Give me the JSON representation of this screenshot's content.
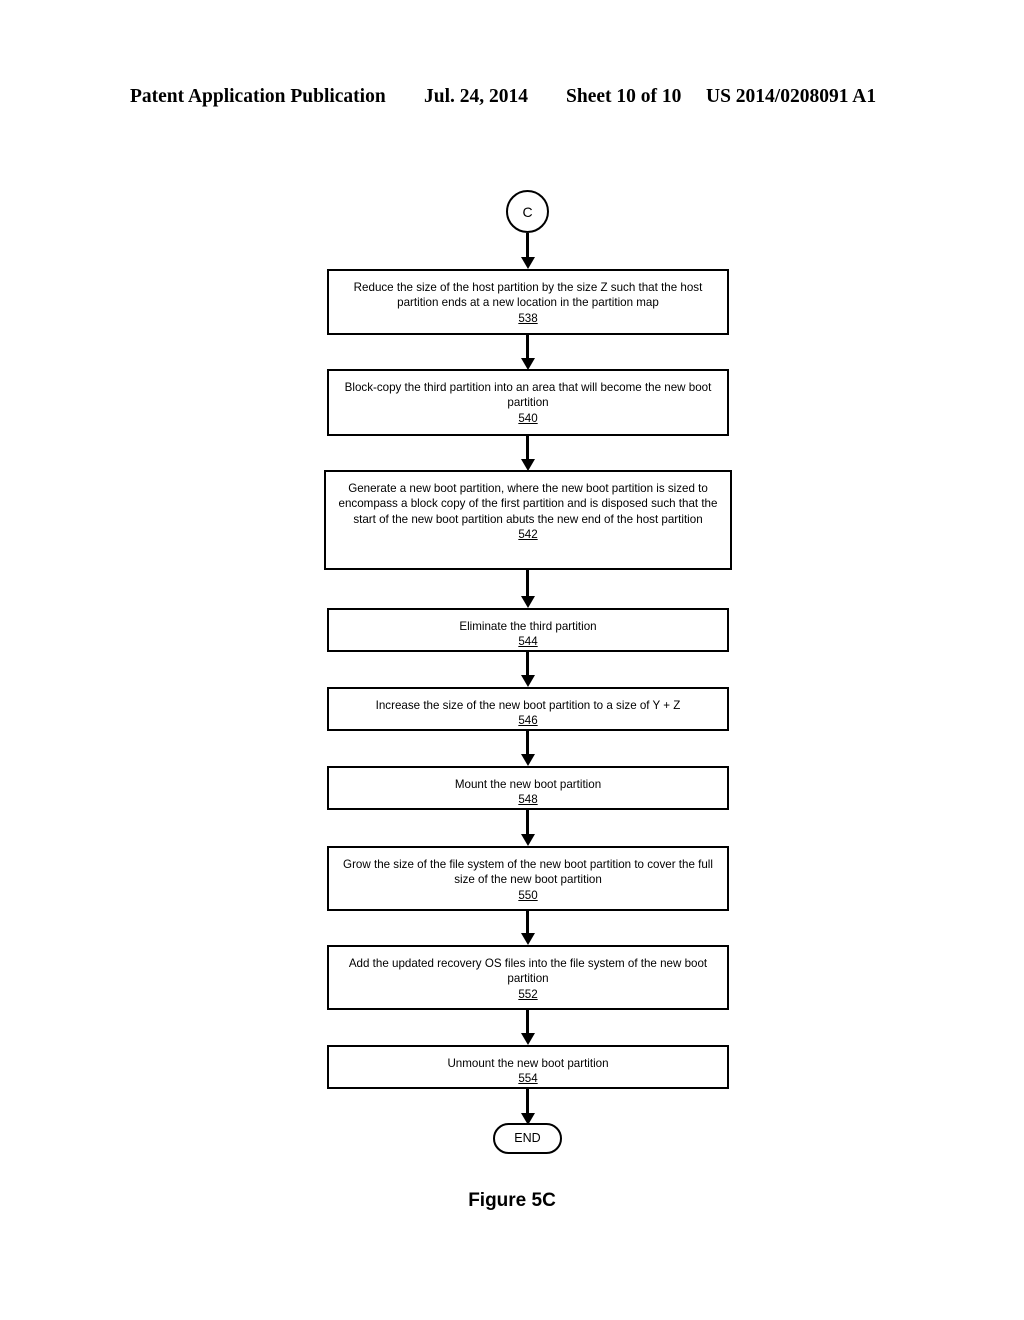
{
  "header": {
    "publication": "Patent Application Publication",
    "date": "Jul. 24, 2014",
    "sheet": "Sheet 10 of 10",
    "patent_number": "US 2014/0208091 A1"
  },
  "figure": {
    "caption": "Figure 5C",
    "entry_connector": "C",
    "terminator": "END"
  },
  "flowchart": {
    "type": "flowchart",
    "nodes": [
      {
        "id": "538",
        "text": "Reduce the size of the host partition by the size Z such that the host partition ends at a new location in the partition map",
        "ref": "538"
      },
      {
        "id": "540",
        "text": "Block-copy the third partition into an area that will become the new boot partition",
        "ref": "540"
      },
      {
        "id": "542",
        "text": "Generate a new boot partition, where the new boot partition is sized to encompass a block copy of the first partition and is disposed such that the start of the new boot partition abuts the new end of the host partition",
        "ref": "542"
      },
      {
        "id": "544",
        "text": "Eliminate the third partition",
        "ref": "544"
      },
      {
        "id": "546",
        "text": "Increase the size of the new boot partition to a size of Y + Z",
        "ref": "546"
      },
      {
        "id": "548",
        "text": "Mount the new boot partition",
        "ref": "548"
      },
      {
        "id": "550",
        "text": "Grow the size of the file system of the new boot partition to cover the full size of the new boot partition",
        "ref": "550"
      },
      {
        "id": "552",
        "text": "Add the updated recovery OS files into the file system of the new boot partition",
        "ref": "552"
      },
      {
        "id": "554",
        "text": "Unmount the new boot partition",
        "ref": "554"
      }
    ]
  }
}
